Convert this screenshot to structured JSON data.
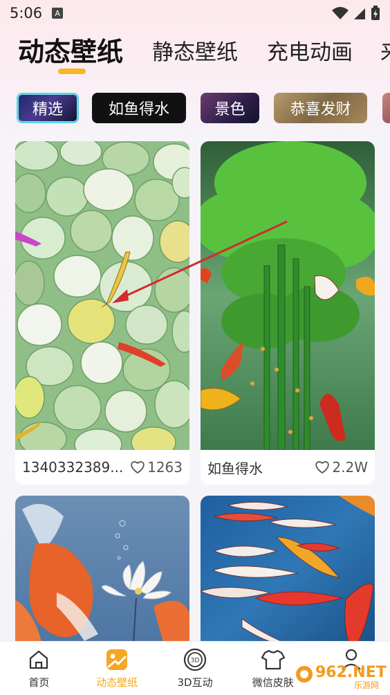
{
  "status": {
    "time": "5:06",
    "badge": "A"
  },
  "top_tabs": [
    {
      "label": "动态壁纸",
      "active": true
    },
    {
      "label": "静态壁纸",
      "active": false
    },
    {
      "label": "充电动画",
      "active": false
    },
    {
      "label": "来",
      "active": false
    }
  ],
  "chips": [
    {
      "label": "精选",
      "selected": true
    },
    {
      "label": "如鱼得水",
      "selected": false
    },
    {
      "label": "景色",
      "selected": false
    },
    {
      "label": "恭喜发财",
      "selected": false
    },
    {
      "label": "",
      "selected": false
    }
  ],
  "cards": [
    {
      "title": "1340332389...",
      "likes": "1263",
      "image": "green-pebbles-koi"
    },
    {
      "title": "如鱼得水",
      "likes": "2.2W",
      "image": "bamboo-koi"
    },
    {
      "title": "",
      "likes": "",
      "image": "koi-lotus-blue"
    },
    {
      "title": "",
      "likes": "",
      "image": "koi-pond"
    }
  ],
  "nav": [
    {
      "label": "首页",
      "icon": "home-icon",
      "active": false
    },
    {
      "label": "动态壁纸",
      "icon": "dynamic-wallpaper-icon",
      "active": true
    },
    {
      "label": "3D互动",
      "icon": "3d-icon",
      "active": false
    },
    {
      "label": "微信皮肤",
      "icon": "shirt-icon",
      "active": false
    },
    {
      "label": "",
      "icon": "profile-icon",
      "active": false
    }
  ],
  "watermark": {
    "text": "962.NET",
    "subtext": "乐游网"
  },
  "colors": {
    "accent": "#f7b722",
    "chip_border": "#4fd6ea"
  }
}
